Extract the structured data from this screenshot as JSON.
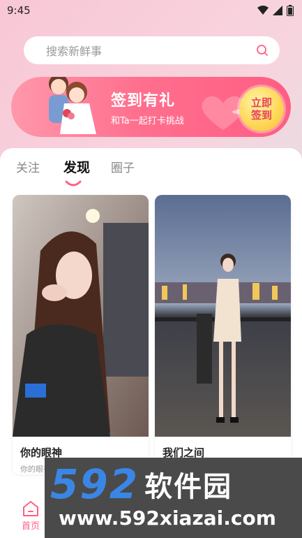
{
  "status_bar": {
    "time": "9:45"
  },
  "search": {
    "placeholder": "搜索新鲜事"
  },
  "banner": {
    "title": "签到有礼",
    "subtitle": "和Ta一起打卡挑战",
    "button_line1": "立即",
    "button_line2": "签到"
  },
  "tabs": [
    {
      "label": "关注"
    },
    {
      "label": "发现",
      "active": true
    },
    {
      "label": "圈子"
    }
  ],
  "cards": [
    {
      "title": "你的眼神",
      "desc": "你的眼神"
    },
    {
      "title": "我们之间",
      "desc": ""
    }
  ],
  "bottom_nav": {
    "home_label": "首页"
  },
  "watermark": {
    "logo_num": "592",
    "logo_cn": "软件园",
    "url": "www.592xiazai.com"
  },
  "colors": {
    "accent": "#ff5e83",
    "banner_btn": "#ffd95a",
    "watermark_blue": "#3a86e6"
  }
}
